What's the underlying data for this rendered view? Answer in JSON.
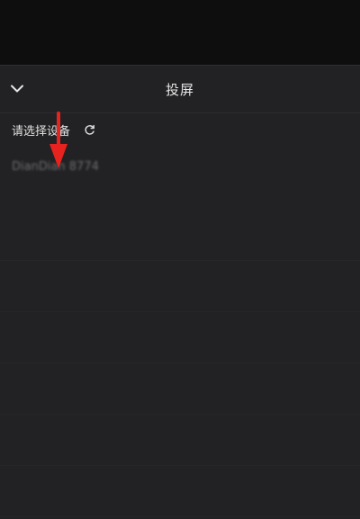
{
  "panel": {
    "title": "投屏",
    "subtitle": "请选择设备"
  },
  "icons": {
    "collapse": "chevron-down-icon",
    "refresh": "refresh-icon",
    "pointer": "red-arrow-down-icon"
  },
  "devices": [
    {
      "name": "DianDian 8774"
    }
  ],
  "colors": {
    "background": "#1f1f21",
    "arrow": "#e8231f",
    "text": "#e6e6e6",
    "blurred_text": "#6e6e70"
  }
}
